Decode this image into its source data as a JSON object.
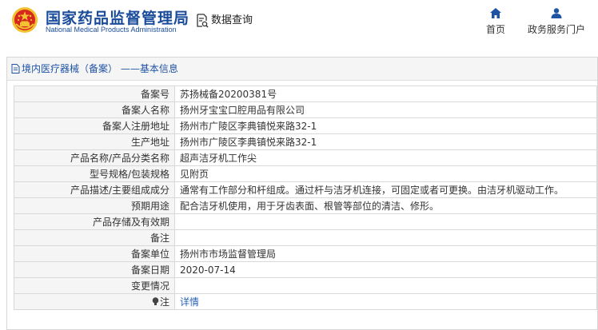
{
  "header": {
    "brand_cn": "国家药品监督管理局",
    "brand_en": "National Medical Products Administration",
    "search_title": "数据查询",
    "nav": [
      {
        "label": "首页",
        "icon": "home-icon"
      },
      {
        "label": "政务服务门户",
        "icon": "user-icon"
      }
    ]
  },
  "panel": {
    "title": "境内医疗器械（备案） ——基本信息"
  },
  "rows": [
    {
      "key": "备案号",
      "value": "苏扬械备20200381号"
    },
    {
      "key": "备案人名称",
      "value": "扬州牙宝宝口腔用品有限公司"
    },
    {
      "key": "备案人注册地址",
      "value": "扬州市广陵区李典镇悦来路32-1"
    },
    {
      "key": "生产地址",
      "value": "扬州市广陵区李典镇悦来路32-1"
    },
    {
      "key": "产品名称/产品分类名称",
      "value": "超声洁牙机工作尖"
    },
    {
      "key": "型号规格/包装规格",
      "value": "见附页"
    },
    {
      "key": "产品描述/主要组成成分",
      "value": "通常有工作部分和杆组成。通过杆与洁牙机连接，可固定或者可更换。由洁牙机驱动工作。"
    },
    {
      "key": "预期用途",
      "value": "配合洁牙机使用，用于牙齿表面、根管等部位的清洁、修形。"
    },
    {
      "key": "产品存储及有效期",
      "value": ""
    },
    {
      "key": "备注",
      "value": ""
    },
    {
      "key": "备案单位",
      "value": "扬州市市场监督管理局"
    },
    {
      "key": "备案日期",
      "value": "2020-07-14"
    },
    {
      "key": "变更情况",
      "value": ""
    },
    {
      "key": "注",
      "value": "详情",
      "link": true
    }
  ],
  "colors": {
    "brand": "#1a4c9b",
    "emblem_red": "#d7261e",
    "emblem_gold": "#f2c230",
    "link": "#2a63b8",
    "label_bg": "#f5f5f5"
  }
}
